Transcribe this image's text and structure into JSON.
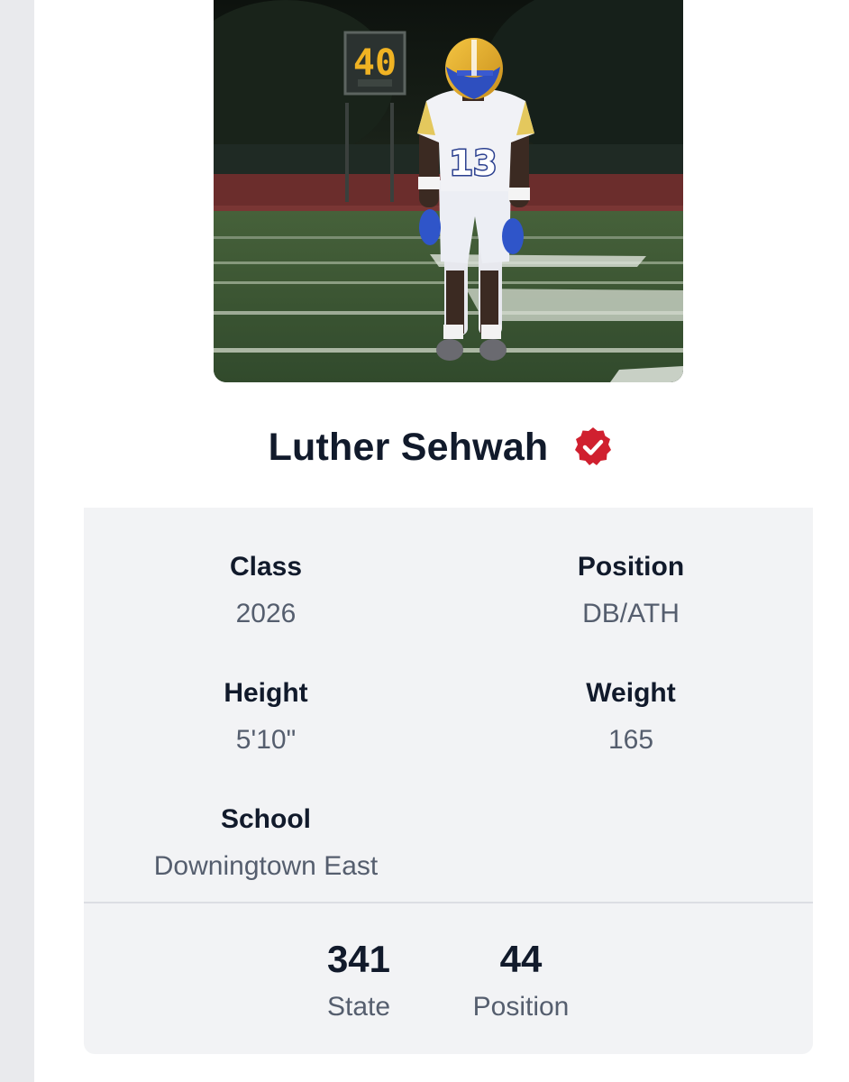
{
  "profile": {
    "name": "Luther Sehwah",
    "verified_icon": "verified-check-badge-icon",
    "photo_scoreboard_text": "40",
    "photo_jersey_number": "13"
  },
  "attributes": [
    {
      "label": "Class",
      "value": "2026"
    },
    {
      "label": "Position",
      "value": "DB/ATH"
    },
    {
      "label": "Height",
      "value": "5'10\""
    },
    {
      "label": "Weight",
      "value": "165"
    },
    {
      "label": "School",
      "value": "Downingtown East"
    }
  ],
  "rankings": [
    {
      "value": "341",
      "label": "State"
    },
    {
      "value": "44",
      "label": "Position"
    }
  ],
  "colors": {
    "accent_red": "#d0202f",
    "text_dark": "#111a2b",
    "text_muted": "#555e6e",
    "panel_bg": "#f2f3f5"
  }
}
